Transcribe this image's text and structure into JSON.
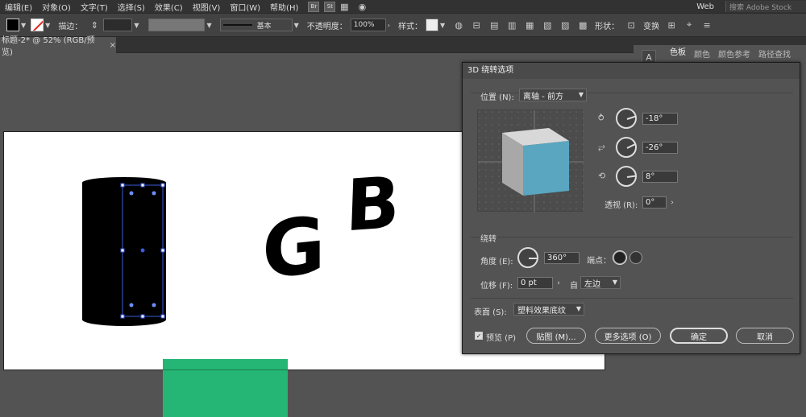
{
  "menu": [
    "编辑(E)",
    "对象(O)",
    "文字(T)",
    "选择(S)",
    "效果(C)",
    "视图(V)",
    "窗口(W)",
    "帮助(H)"
  ],
  "menu_badges": [
    "Br",
    "St"
  ],
  "workspace": "Web",
  "search_placeholder": "搜索 Adobe Stock",
  "control": {
    "stroke_label": "描边：",
    "stroke_style": "基本",
    "opacity_label": "不透明度：",
    "opacity_value": "100%",
    "style_label": "样式：",
    "shape_label": "形状：",
    "transform_label": "变换"
  },
  "doc_tab": "标题-2* @ 52% (RGB/预览)",
  "doc_tab_close": "×",
  "right_panel_tabs": [
    "色板",
    "颜色",
    "颜色参考",
    "路径查找"
  ],
  "dialog": {
    "title": "3D 绕转选项",
    "position_label": "位置 (N):",
    "position_value": "离轴 - 前方",
    "rot_x": "-18°",
    "rot_y": "-26°",
    "rot_z": "8°",
    "perspective_label": "透视 (R):",
    "perspective_value": "0°",
    "revolve_section": "绕转",
    "angle_label": "角度 (E):",
    "angle_value": "360°",
    "cap_label": "端点：",
    "offset_label": "位移 (F):",
    "offset_value": "0 pt",
    "from_label": "自",
    "from_value": "左边",
    "surface_label": "表面 (S):",
    "surface_value": "塑料效果底纹",
    "preview_label": "预览 (P)",
    "map_button": "贴图 (M)...",
    "more_button": "更多选项 (O)",
    "ok_button": "确定",
    "cancel_button": "取消"
  },
  "canvas_text": [
    "G",
    "B"
  ],
  "colors": {
    "cube_front": "#5aa6c1",
    "cube_top": "#d8d8d8",
    "cube_side": "#a8a8a8",
    "green": "#25b574",
    "selection": "#3b5bdb"
  }
}
